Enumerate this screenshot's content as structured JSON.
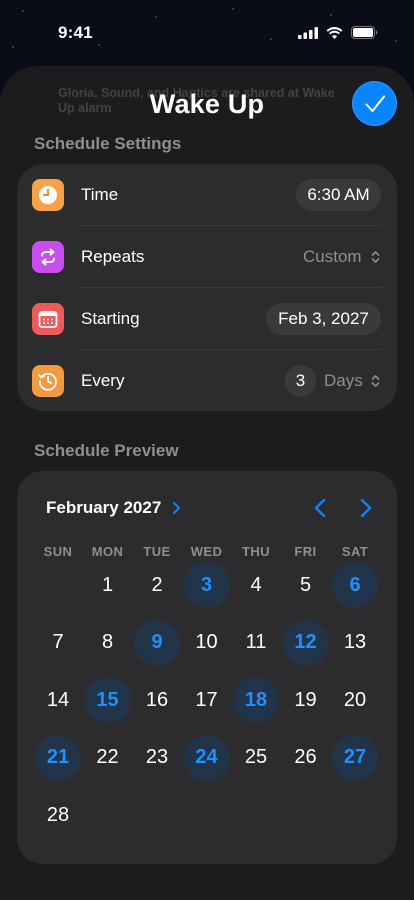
{
  "status_bar": {
    "time": "9:41"
  },
  "ghost_text": "Gloria, Sound, and Haptics are shared at Wake Up alarm",
  "sheet": {
    "title": "Wake Up"
  },
  "settings": {
    "header": "Schedule Settings",
    "time": {
      "label": "Time",
      "value": "6:30 AM"
    },
    "repeats": {
      "label": "Repeats",
      "value": "Custom"
    },
    "starting": {
      "label": "Starting",
      "value": "Feb 3, 2027"
    },
    "every": {
      "label": "Every",
      "count": "3",
      "unit": "Days"
    }
  },
  "preview": {
    "header": "Schedule Preview",
    "month": "February 2027",
    "weekdays": [
      "SUN",
      "MON",
      "TUE",
      "WED",
      "THU",
      "FRI",
      "SAT"
    ],
    "first_weekday_index": 1,
    "days": [
      "1",
      "2",
      "3",
      "4",
      "5",
      "6",
      "7",
      "8",
      "9",
      "10",
      "11",
      "12",
      "13",
      "14",
      "15",
      "16",
      "17",
      "18",
      "19",
      "20",
      "21",
      "22",
      "23",
      "24",
      "25",
      "26",
      "27",
      "28"
    ],
    "highlighted": [
      "3",
      "6",
      "9",
      "12",
      "15",
      "18",
      "21",
      "24",
      "27"
    ]
  },
  "colors": {
    "accent": "#0a84ff",
    "time_icon": "#f7a14a",
    "repeats_icon": "#c84ef0",
    "starting_icon": "#ef5b5b",
    "every_icon": "#f39a3e"
  }
}
